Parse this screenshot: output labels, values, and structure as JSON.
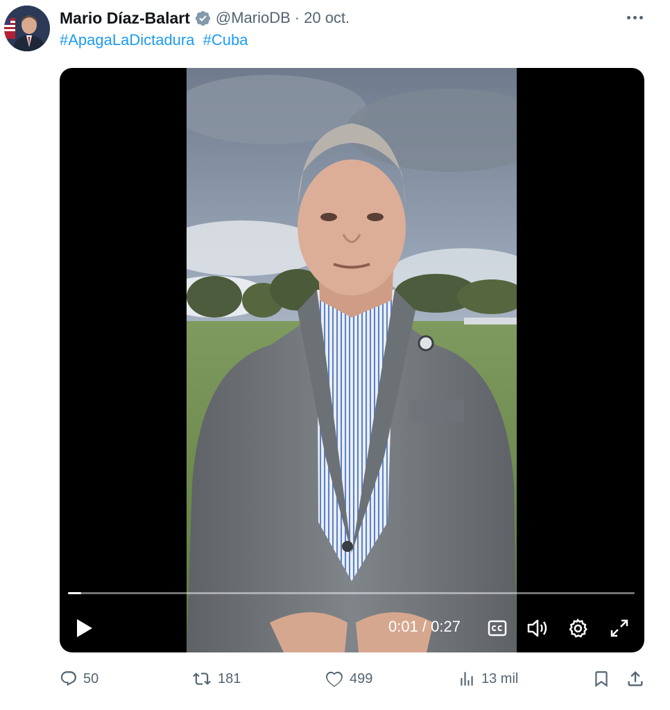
{
  "tweet": {
    "author_name": "Mario Díaz-Balart",
    "handle": "@MarioDB",
    "separator": "·",
    "date": "20 oct.",
    "hashtags": [
      "#ApagaLaDictadura",
      "#Cuba"
    ],
    "verified_icon": "verified-badge-icon",
    "more_icon": "more-options-icon"
  },
  "video": {
    "current_time": "0:01",
    "duration": "0:27",
    "time_display": "0:01 / 0:27",
    "progress": 0.023,
    "icons": [
      "play-icon",
      "captions-icon",
      "volume-icon",
      "settings-icon",
      "fullscreen-icon"
    ]
  },
  "actions": {
    "replies": "50",
    "retweets": "181",
    "likes": "499",
    "views": "13 mil"
  },
  "colors": {
    "text": "#0f1419",
    "secondary": "#536471",
    "link": "#1d9bf0",
    "verified": "#829aab",
    "video_bg": "#000000"
  }
}
